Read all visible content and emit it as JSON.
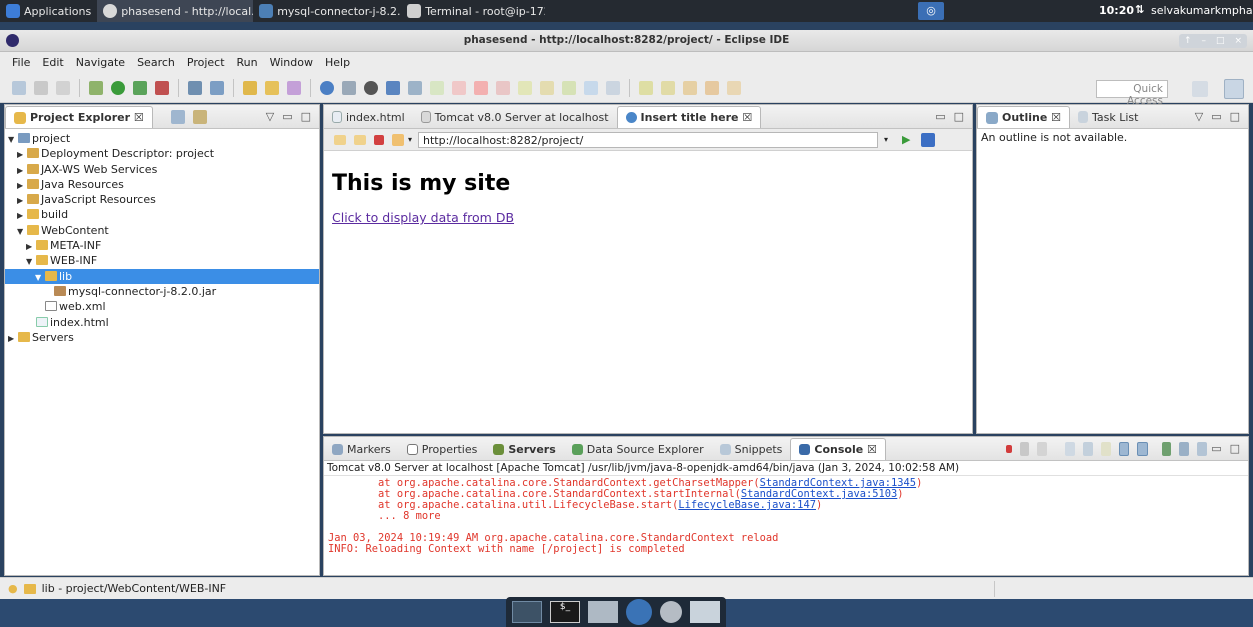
{
  "taskbar": {
    "applications": "Applications",
    "tasks": [
      "phasesend - http://local...",
      "mysql-connector-j-8.2.0...",
      "Terminal - root@ip-172-..."
    ],
    "clock": "10:20",
    "user": "selvakumarkmpha"
  },
  "window": {
    "title": "phasesend - http://localhost:8282/project/ - Eclipse IDE"
  },
  "menu": [
    "File",
    "Edit",
    "Navigate",
    "Search",
    "Project",
    "Run",
    "Window",
    "Help"
  ],
  "toolbar": {
    "quick_access": "Quick Access"
  },
  "project_explorer": {
    "tab_label": "Project Explorer ☒",
    "tree": [
      {
        "label": "project",
        "depth": 0,
        "toggle": "▼"
      },
      {
        "label": "Deployment Descriptor: project",
        "depth": 1,
        "toggle": "▶"
      },
      {
        "label": "JAX-WS Web Services",
        "depth": 1,
        "toggle": "▶"
      },
      {
        "label": "Java Resources",
        "depth": 1,
        "toggle": "▶"
      },
      {
        "label": "JavaScript Resources",
        "depth": 1,
        "toggle": "▶"
      },
      {
        "label": "build",
        "depth": 1,
        "toggle": "▶"
      },
      {
        "label": "WebContent",
        "depth": 1,
        "toggle": "▼"
      },
      {
        "label": "META-INF",
        "depth": 2,
        "toggle": "▶"
      },
      {
        "label": "WEB-INF",
        "depth": 2,
        "toggle": "▼"
      },
      {
        "label": "lib",
        "depth": 3,
        "toggle": "▼",
        "selected": true
      },
      {
        "label": "mysql-connector-j-8.2.0.jar",
        "depth": 4,
        "toggle": ""
      },
      {
        "label": "web.xml",
        "depth": 3,
        "toggle": ""
      },
      {
        "label": "index.html",
        "depth": 2,
        "toggle": ""
      },
      {
        "label": "Servers",
        "depth": 0,
        "toggle": "▶"
      }
    ]
  },
  "editor": {
    "tabs": [
      "index.html",
      "Tomcat v8.0 Server at localhost",
      "Insert title here ☒"
    ],
    "url": "http://localhost:8282/project/",
    "heading": "This is my site",
    "link": "Click to display data from DB"
  },
  "outline": {
    "tabs": [
      "Outline ☒",
      "Task List"
    ],
    "message": "An outline is not available."
  },
  "console": {
    "tabs": [
      "Markers",
      "Properties",
      "Servers",
      "Data Source Explorer",
      "Snippets",
      "Console ☒"
    ],
    "header": "Tomcat v8.0 Server at localhost [Apache Tomcat] /usr/lib/jvm/java-8-openjdk-amd64/bin/java (Jan 3, 2024, 10:02:58 AM)",
    "lines": [
      {
        "pre": "        at org.apache.catalina.core.StandardContext.getCharsetMapper(",
        "link": "StandardContext.java:1345",
        "post": ")"
      },
      {
        "pre": "        at org.apache.catalina.core.StandardContext.startInternal(",
        "link": "StandardContext.java:5103",
        "post": ")"
      },
      {
        "pre": "        at org.apache.catalina.util.LifecycleBase.start(",
        "link": "LifecycleBase.java:147",
        "post": ")"
      },
      {
        "pre": "        ... 8 more",
        "link": "",
        "post": ""
      },
      {
        "pre": " ",
        "link": "",
        "post": ""
      },
      {
        "pre": "Jan 03, 2024 10:19:49 AM org.apache.catalina.core.StandardContext reload",
        "link": "",
        "post": ""
      },
      {
        "pre": "INFO: Reloading Context with name [/project] is completed",
        "link": "",
        "post": ""
      }
    ]
  },
  "status": {
    "text": "lib - project/WebContent/WEB-INF"
  }
}
